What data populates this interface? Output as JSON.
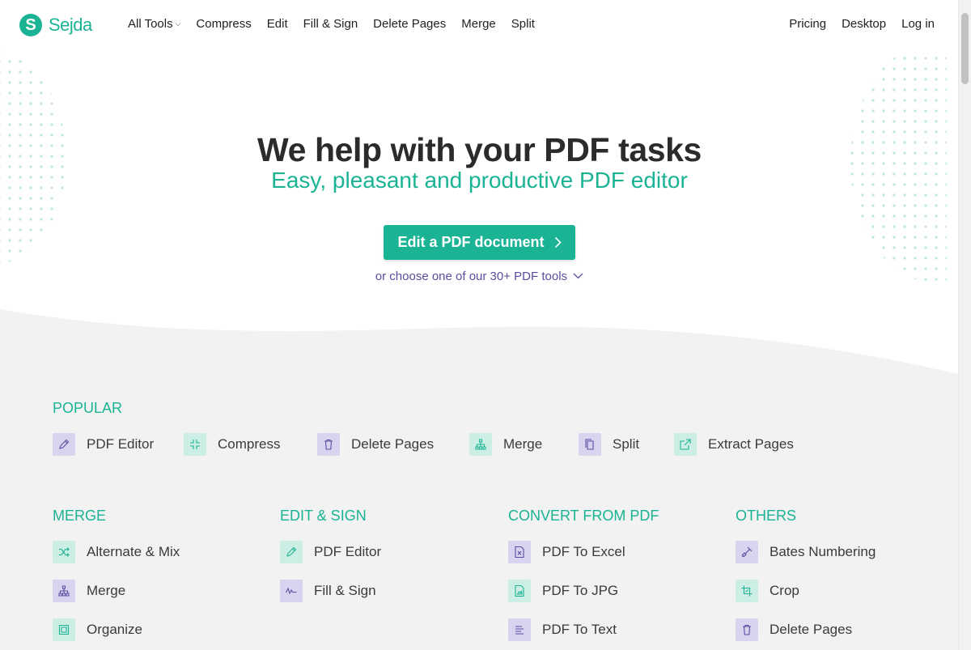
{
  "brand": {
    "logo_letter": "S",
    "name": "Sejda",
    "accent": "#1ab394",
    "secondary": "#5a4c9e"
  },
  "nav": {
    "left": [
      "All Tools",
      "Compress",
      "Edit",
      "Fill & Sign",
      "Delete Pages",
      "Merge",
      "Split"
    ],
    "right": [
      "Pricing",
      "Desktop",
      "Log in"
    ]
  },
  "hero": {
    "title": "We help with your PDF tasks",
    "subtitle": "Easy, pleasant and productive PDF editor",
    "cta": "Edit a PDF document",
    "choose": "or choose one of our 30+ PDF tools"
  },
  "popular": {
    "title": "POPULAR",
    "items": [
      {
        "label": "PDF Editor",
        "icon": "pencil-icon"
      },
      {
        "label": "Compress",
        "icon": "compress-icon"
      },
      {
        "label": "Delete Pages",
        "icon": "trash-icon"
      },
      {
        "label": "Merge",
        "icon": "merge-icon"
      },
      {
        "label": "Split",
        "icon": "split-icon"
      },
      {
        "label": "Extract Pages",
        "icon": "extract-icon"
      }
    ]
  },
  "categories": [
    {
      "title": "MERGE",
      "items": [
        {
          "label": "Alternate & Mix",
          "icon": "shuffle-icon"
        },
        {
          "label": "Merge",
          "icon": "merge-icon"
        },
        {
          "label": "Organize",
          "icon": "organize-icon"
        }
      ]
    },
    {
      "title": "EDIT & SIGN",
      "items": [
        {
          "label": "PDF Editor",
          "icon": "pencil-icon"
        },
        {
          "label": "Fill & Sign",
          "icon": "signature-icon"
        }
      ]
    },
    {
      "title": "CONVERT FROM PDF",
      "items": [
        {
          "label": "PDF To Excel",
          "icon": "excel-file-icon"
        },
        {
          "label": "PDF To JPG",
          "icon": "image-file-icon"
        },
        {
          "label": "PDF To Text",
          "icon": "text-lines-icon"
        }
      ]
    },
    {
      "title": "OTHERS",
      "items": [
        {
          "label": "Bates Numbering",
          "icon": "stamp-icon"
        },
        {
          "label": "Crop",
          "icon": "crop-icon"
        },
        {
          "label": "Delete Pages",
          "icon": "trash-icon"
        }
      ]
    }
  ]
}
